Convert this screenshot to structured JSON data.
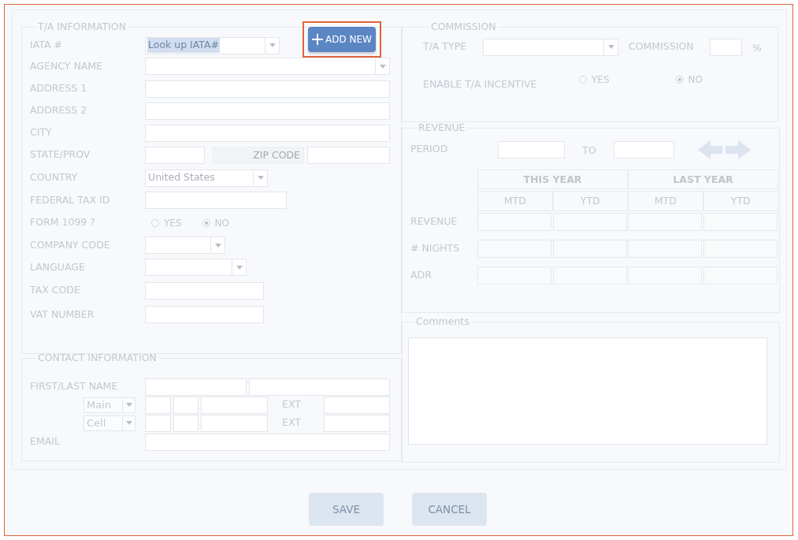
{
  "ta_information": {
    "title": "T/A INFORMATION",
    "add_new_button": {
      "label": "ADD NEW",
      "highlighted": true
    },
    "fields": [
      {
        "kind": "dropdown",
        "label": "IATA #",
        "value": "Look up IATA#",
        "value_selected": true
      },
      {
        "kind": "dropdown",
        "label": "AGENCY NAME"
      },
      {
        "kind": "text",
        "label": "ADDRESS 1"
      },
      {
        "kind": "text",
        "label": "ADDRESS 2"
      },
      {
        "kind": "text",
        "label": "CITY"
      },
      {
        "kind": "state_zip",
        "label": "STATE/PROV",
        "zip_label": "ZIP CODE"
      },
      {
        "kind": "dropdown",
        "label": "COUNTRY",
        "value": "United States"
      },
      {
        "kind": "text",
        "label": "FEDERAL TAX ID"
      },
      {
        "kind": "radio",
        "label": "FORM 1099 ?",
        "options": [
          {
            "label": "YES",
            "selected": false
          },
          {
            "label": "NO",
            "selected": true
          }
        ]
      },
      {
        "kind": "dropdown",
        "label": "COMPANY CODE"
      },
      {
        "kind": "dropdown",
        "label": "LANGUAGE"
      },
      {
        "kind": "text",
        "label": "TAX CODE"
      },
      {
        "kind": "text",
        "label": "VAT NUMBER"
      }
    ]
  },
  "contact_information": {
    "title": "CONTACT INFORMATION",
    "name_label": "FIRST/LAST NAME",
    "phones": [
      {
        "type": "Main",
        "ext_label": "EXT"
      },
      {
        "type": "Cell",
        "ext_label": "EXT"
      }
    ],
    "email_label": "EMAIL"
  },
  "commission": {
    "title": "COMMISSION",
    "ta_type_label": "T/A TYPE",
    "commission_label": "COMMISSION",
    "percent_sign": "%",
    "incentive_label": "ENABLE T/A INCENTIVE",
    "incentive_options": [
      {
        "label": "YES",
        "selected": false
      },
      {
        "label": "NO",
        "selected": true
      }
    ]
  },
  "revenue": {
    "title": "REVENUE",
    "period_label": "PERIOD",
    "to_label": "TO",
    "column_groups": [
      "THIS YEAR",
      "LAST YEAR"
    ],
    "columns": [
      "MTD",
      "YTD",
      "MTD",
      "YTD"
    ],
    "rows": [
      "REVENUE",
      "# NIGHTS",
      "ADR"
    ]
  },
  "comments": {
    "title": "Comments"
  },
  "buttons": [
    {
      "label": "SAVE",
      "disabled": true
    },
    {
      "label": "CANCEL",
      "disabled": true
    }
  ]
}
